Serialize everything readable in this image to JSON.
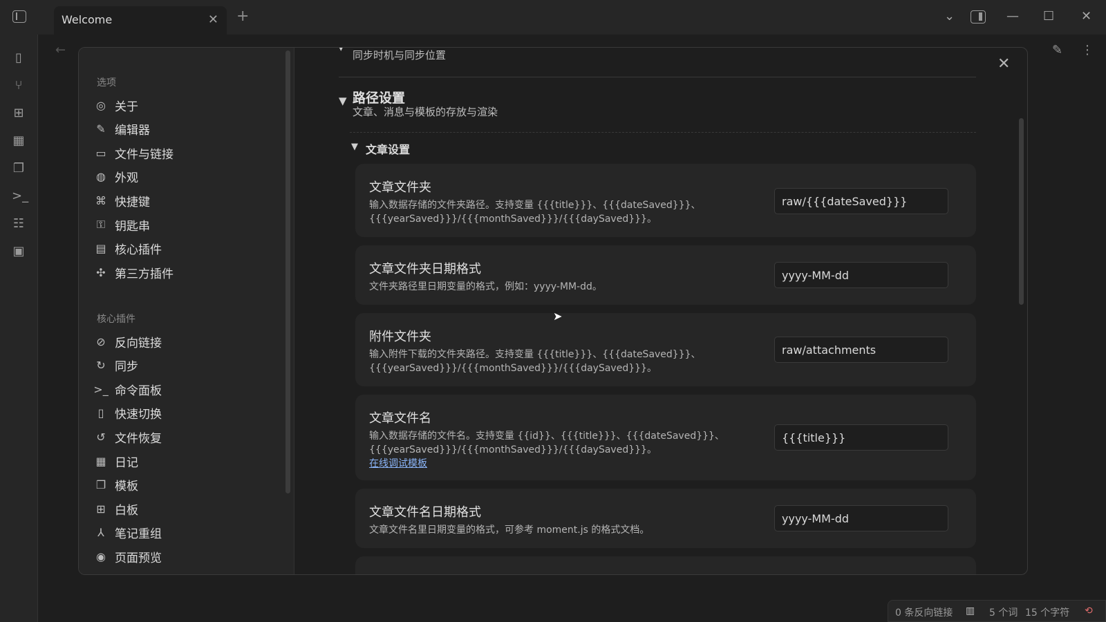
{
  "tab": {
    "title": "Welcome",
    "close": "✕",
    "new": "+"
  },
  "window": {
    "minimize": "—",
    "maximize": "☐",
    "close": "✕",
    "tab_list": "⌄"
  },
  "settings": {
    "close": "✕",
    "section_options": "选项",
    "options": [
      {
        "icon": "user-circle-icon",
        "glyph": "◎",
        "label": "关于"
      },
      {
        "icon": "pencil-icon",
        "glyph": "✎",
        "label": "编辑器"
      },
      {
        "icon": "folder-icon",
        "glyph": "▭",
        "label": "文件与链接"
      },
      {
        "icon": "palette-icon",
        "glyph": "◍",
        "label": "外观"
      },
      {
        "icon": "command-icon",
        "glyph": "⌘",
        "label": "快捷键"
      },
      {
        "icon": "key-icon",
        "glyph": "⚿",
        "label": "钥匙串"
      },
      {
        "icon": "calendar-plugin-icon",
        "glyph": "▤",
        "label": "核心插件"
      },
      {
        "icon": "puzzle-icon",
        "glyph": "✣",
        "label": "第三方插件"
      }
    ],
    "section_core": "核心插件",
    "core": [
      {
        "icon": "backlink-icon",
        "glyph": "⊘",
        "label": "反向链接"
      },
      {
        "icon": "sync-icon",
        "glyph": "↻",
        "label": "同步"
      },
      {
        "icon": "terminal-icon",
        "glyph": ">_",
        "label": "命令面板"
      },
      {
        "icon": "file-switch-icon",
        "glyph": "▯",
        "label": "快速切换"
      },
      {
        "icon": "history-icon",
        "glyph": "↺",
        "label": "文件恢复"
      },
      {
        "icon": "calendar-icon",
        "glyph": "▦",
        "label": "日记"
      },
      {
        "icon": "copy-icon",
        "glyph": "❐",
        "label": "模板"
      },
      {
        "icon": "grid-icon",
        "glyph": "⊞",
        "label": "白板"
      },
      {
        "icon": "merge-icon",
        "glyph": "⅄",
        "label": "笔记重组"
      },
      {
        "icon": "preview-icon",
        "glyph": "◉",
        "label": "页面预览"
      }
    ],
    "sync_desc": "同步时机与同步位置",
    "path": {
      "title": "路径设置",
      "desc": "文章、消息与模板的存放与渲染"
    },
    "article_section": "文章设置",
    "cards": [
      {
        "name": "文章文件夹",
        "desc1": "输入数据存储的文件夹路径。支持变量 {{{title}}}、{{{dateSaved}}}、",
        "desc2": "{{{yearSaved}}}/{{{monthSaved}}}/{{{daySaved}}}。",
        "value": "raw/{{{dateSaved}}}"
      },
      {
        "name": "文章文件夹日期格式",
        "desc1": "文件夹路径里日期变量的格式，例如：yyyy-MM-dd。",
        "value": "yyyy-MM-dd"
      },
      {
        "name": "附件文件夹",
        "desc1": "输入附件下载的文件夹路径。支持变量 {{{title}}}、{{{dateSaved}}}、",
        "desc2": "{{{yearSaved}}}/{{{monthSaved}}}/{{{daySaved}}}。",
        "value": "raw/attachments"
      },
      {
        "name": "文章文件名",
        "desc1": "输入数据存储的文件名。支持变量 {{id}}、{{{title}}}、{{{dateSaved}}}、",
        "desc2": "{{{yearSaved}}}/{{{monthSaved}}}/{{{daySaved}}}。",
        "link": "在线调试模板",
        "value": "{{{title}}}"
      },
      {
        "name": "文章文件名日期格式",
        "desc1": "文章文件名里日期变量的格式，可参考 moment.js 的格式文档。",
        "value": "yyyy-MM-dd"
      }
    ]
  },
  "status": {
    "backlinks": "0 条反向链接",
    "words": "5 个词",
    "chars": "15 个字符"
  }
}
